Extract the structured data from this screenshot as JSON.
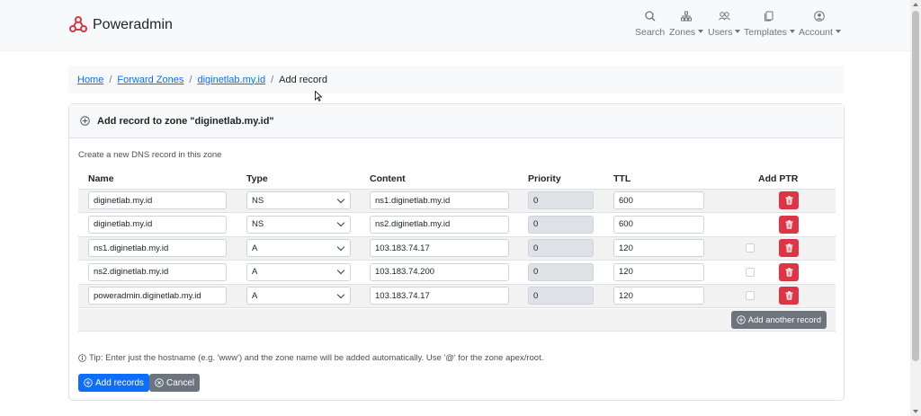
{
  "brand": {
    "name": "Poweradmin"
  },
  "nav": [
    {
      "label": "Search",
      "icon": "search-icon",
      "dropdown": false
    },
    {
      "label": "Zones",
      "icon": "sitemap-icon",
      "dropdown": true
    },
    {
      "label": "Users",
      "icon": "users-icon",
      "dropdown": true
    },
    {
      "label": "Templates",
      "icon": "copy-icon",
      "dropdown": true
    },
    {
      "label": "Account",
      "icon": "person-circle-icon",
      "dropdown": true
    }
  ],
  "breadcrumb": {
    "home": "Home",
    "forward": "Forward Zones",
    "zone": "diginetlab.my.id",
    "current": "Add record"
  },
  "card": {
    "title": "Add record to zone \"diginetlab.my.id\"",
    "subtitle": "Create a new DNS record in this zone"
  },
  "table": {
    "headers": {
      "name": "Name",
      "type": "Type",
      "content": "Content",
      "priority": "Priority",
      "ttl": "TTL",
      "ptr": "Add PTR"
    },
    "rows": [
      {
        "name": "diginetlab.my.id",
        "type": "NS",
        "content": "ns1.diginetlab.my.id",
        "priority": "0",
        "ttl": "600",
        "ptr": false
      },
      {
        "name": "diginetlab.my.id",
        "type": "NS",
        "content": "ns2.diginetlab.my.id",
        "priority": "0",
        "ttl": "600",
        "ptr": false
      },
      {
        "name": "ns1.diginetlab.my.id",
        "type": "A",
        "content": "103.183.74.17",
        "priority": "0",
        "ttl": "120",
        "ptr": true
      },
      {
        "name": "ns2.diginetlab.my.id",
        "type": "A",
        "content": "103.183.74.200",
        "priority": "0",
        "ttl": "120",
        "ptr": true
      },
      {
        "name": "poweradmin.diginetlab.my.id",
        "type": "A",
        "content": "103.183.74.17",
        "priority": "0",
        "ttl": "120",
        "ptr": true
      }
    ]
  },
  "buttons": {
    "add_another": "Add another record",
    "add_records": "Add records",
    "cancel": "Cancel"
  },
  "tip": "Tip: Enter just the hostname (e.g. 'www') and the zone name will be added automatically. Use '@' for the zone apex/root.",
  "colors": {
    "primary": "#0d6efd",
    "danger": "#dc3545",
    "secondary": "#6c757d",
    "brand": "#dc3545"
  }
}
